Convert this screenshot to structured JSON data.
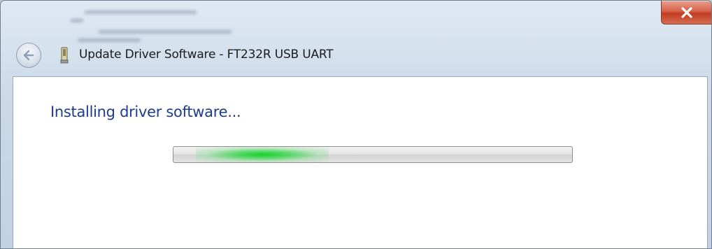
{
  "window": {
    "title": "Update Driver Software - FT232R USB UART",
    "close_icon": "close-x-icon",
    "back_icon": "back-arrow-icon",
    "device_icon": "usb-device-icon"
  },
  "content": {
    "heading": "Installing driver software...",
    "progress": {
      "type": "marquee",
      "glow_position": 0.17
    }
  },
  "colors": {
    "heading": "#1f3d8f",
    "progress_glow": "#14d228",
    "close_button": "#c9452a"
  }
}
